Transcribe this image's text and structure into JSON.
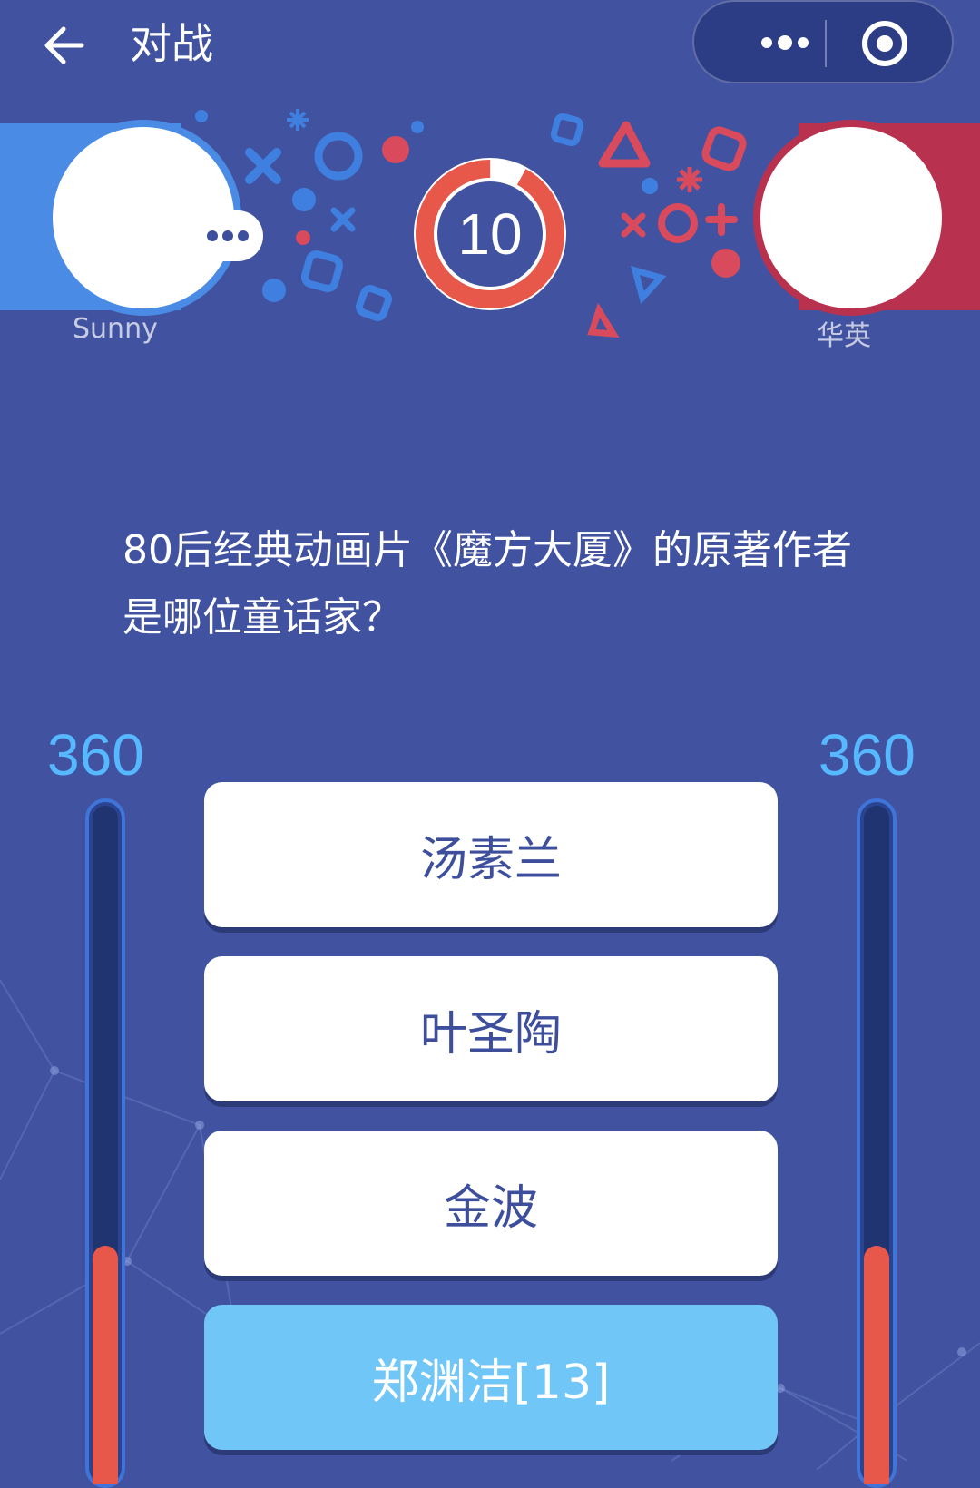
{
  "header": {
    "title": "对战",
    "back_icon": "arrow-left-icon",
    "more_icon": "more-dots-icon",
    "close_icon": "target-icon"
  },
  "players": {
    "left": {
      "name": "Sunny",
      "color": "#4a8be6",
      "status_icon": "typing-dots-icon"
    },
    "right": {
      "name": "华英",
      "color": "#b8324f"
    }
  },
  "timer": {
    "seconds": "10",
    "progress_fraction": 0.92,
    "color": "#e8584a"
  },
  "question": "80后经典动画片《魔方大厦》的原著作者是哪位童话家？",
  "scores": {
    "left": {
      "value": "360",
      "fill_fraction": 0.35
    },
    "right": {
      "value": "360",
      "fill_fraction": 0.35
    }
  },
  "options": [
    {
      "label": "汤素兰",
      "selected": false
    },
    {
      "label": "叶圣陶",
      "selected": false
    },
    {
      "label": "金波",
      "selected": false
    },
    {
      "label": "郑渊洁[13]",
      "selected": true
    }
  ],
  "colors": {
    "background": "#4153a0",
    "accent_red": "#e8584a",
    "accent_blue": "#56b8ff",
    "selected_option": "#71c6f8"
  }
}
